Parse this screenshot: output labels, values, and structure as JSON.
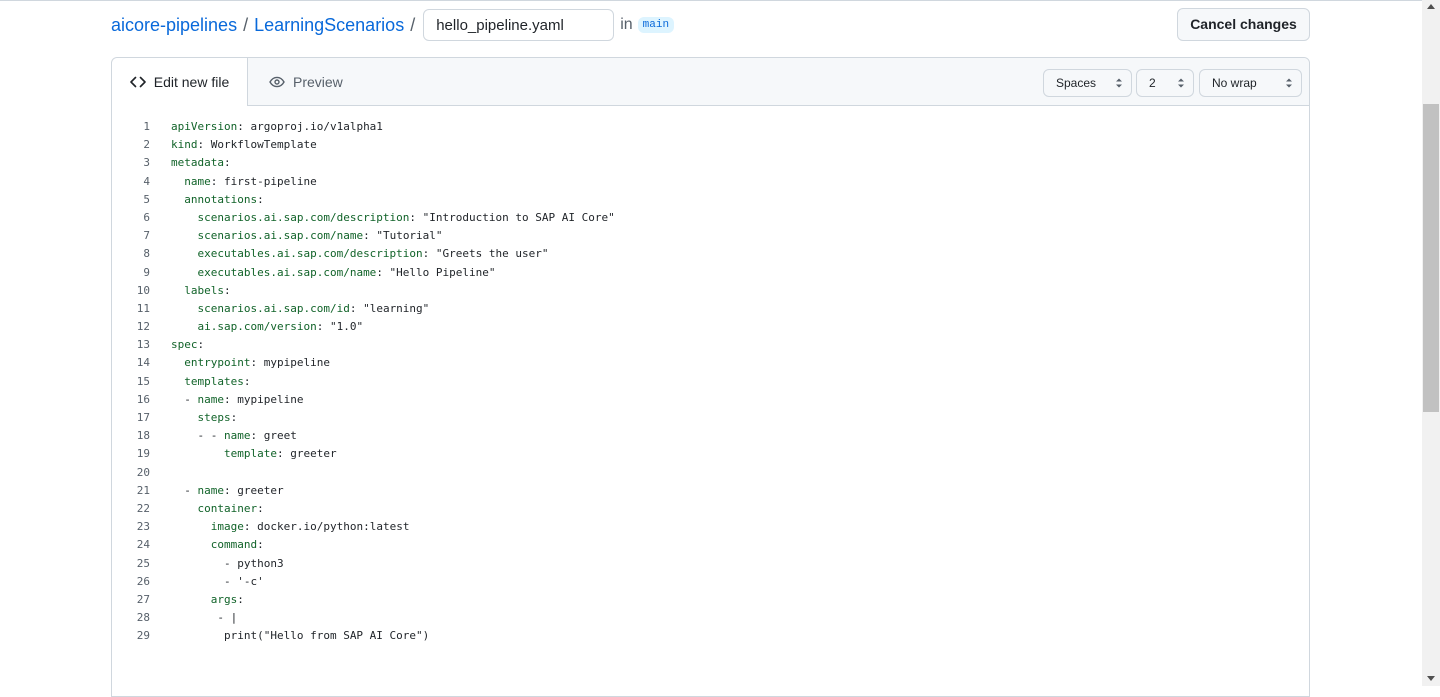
{
  "breadcrumb": {
    "repo": "aicore-pipelines",
    "sep1": "/",
    "folder": "LearningScenarios",
    "sep2": "/",
    "filename_value": "hello_pipeline.yaml",
    "in_word": "in",
    "branch": "main"
  },
  "actions": {
    "cancel_label": "Cancel changes"
  },
  "editor": {
    "tab_edit": {
      "label": "Edit new file",
      "icon": "code-icon"
    },
    "tab_preview": {
      "label": "Preview",
      "icon": "eye-icon"
    },
    "indent_mode": "Spaces",
    "indent_size": "2",
    "wrap_mode": "No wrap",
    "lines": [
      {
        "num": "1",
        "key": "apiVersion",
        "rest": ": argoproj.io/v1alpha1",
        "indent": ""
      },
      {
        "num": "2",
        "key": "kind",
        "rest": ": WorkflowTemplate",
        "indent": ""
      },
      {
        "num": "3",
        "key": "metadata",
        "rest": ":",
        "indent": ""
      },
      {
        "num": "4",
        "key": "name",
        "rest": ": first-pipeline",
        "indent": "  "
      },
      {
        "num": "5",
        "key": "annotations",
        "rest": ":",
        "indent": "  "
      },
      {
        "num": "6",
        "key": "scenarios.ai.sap.com/description",
        "rest": ": \"Introduction to SAP AI Core\"",
        "indent": "    "
      },
      {
        "num": "7",
        "key": "scenarios.ai.sap.com/name",
        "rest": ": \"Tutorial\"",
        "indent": "    "
      },
      {
        "num": "8",
        "key": "executables.ai.sap.com/description",
        "rest": ": \"Greets the user\"",
        "indent": "    "
      },
      {
        "num": "9",
        "key": "executables.ai.sap.com/name",
        "rest": ": \"Hello Pipeline\"",
        "indent": "    "
      },
      {
        "num": "10",
        "key": "labels",
        "rest": ":",
        "indent": "  "
      },
      {
        "num": "11",
        "key": "scenarios.ai.sap.com/id",
        "rest": ": \"learning\"",
        "indent": "    "
      },
      {
        "num": "12",
        "key": "ai.sap.com/version",
        "rest": ": \"1.0\"",
        "indent": "    "
      },
      {
        "num": "13",
        "key": "spec",
        "rest": ":",
        "indent": ""
      },
      {
        "num": "14",
        "key": "entrypoint",
        "rest": ": mypipeline",
        "indent": "  "
      },
      {
        "num": "15",
        "key": "templates",
        "rest": ":",
        "indent": "  "
      },
      {
        "num": "16",
        "key": "name",
        "rest": ": mypipeline",
        "indent": "  - "
      },
      {
        "num": "17",
        "key": "steps",
        "rest": ":",
        "indent": "    "
      },
      {
        "num": "18",
        "key": "name",
        "rest": ": greet",
        "indent": "    - - "
      },
      {
        "num": "19",
        "key": "template",
        "rest": ": greeter",
        "indent": "        "
      },
      {
        "num": "20",
        "key": "",
        "rest": "",
        "indent": ""
      },
      {
        "num": "21",
        "key": "name",
        "rest": ": greeter",
        "indent": "  - "
      },
      {
        "num": "22",
        "key": "container",
        "rest": ":",
        "indent": "    "
      },
      {
        "num": "23",
        "key": "image",
        "rest": ": docker.io/python:latest",
        "indent": "      "
      },
      {
        "num": "24",
        "key": "command",
        "rest": ":",
        "indent": "      "
      },
      {
        "num": "25",
        "key": "",
        "rest": "- python3",
        "indent": "        "
      },
      {
        "num": "26",
        "key": "",
        "rest": "- '-c'",
        "indent": "        "
      },
      {
        "num": "27",
        "key": "args",
        "rest": ":",
        "indent": "      "
      },
      {
        "num": "28",
        "key": "",
        "rest": "- |",
        "indent": "       "
      },
      {
        "num": "29",
        "key": "",
        "rest": "print(\"Hello from SAP AI Core\")",
        "indent": "        "
      }
    ]
  },
  "colors": {
    "link": "#0969da",
    "yaml_key": "#116329",
    "border": "#d0d7de",
    "header_bg": "#f6f8fa"
  }
}
